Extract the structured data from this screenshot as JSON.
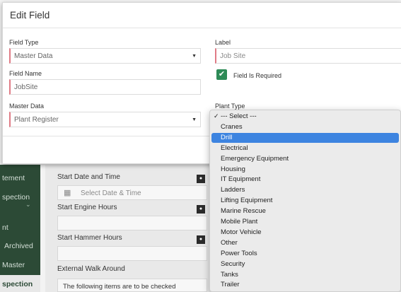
{
  "modal": {
    "title": "Edit Field",
    "field_type": {
      "label": "Field Type",
      "value": "Master Data"
    },
    "field_label": {
      "label": "Label",
      "placeholder": "Job Site"
    },
    "field_name": {
      "label": "Field Name",
      "value": "JobSite"
    },
    "required": {
      "label": "Field Is Required",
      "checked": true
    },
    "master_data": {
      "label": "Master Data",
      "value": "Plant Register"
    },
    "plant_type": {
      "label": "Plant Type"
    }
  },
  "dropdown": {
    "options": [
      {
        "label": "--- Select ---",
        "checked": true
      },
      {
        "label": "Cranes"
      },
      {
        "label": "Drill",
        "highlighted": true
      },
      {
        "label": "Electrical"
      },
      {
        "label": "Emergency Equipment"
      },
      {
        "label": "Housing"
      },
      {
        "label": "IT Equipment"
      },
      {
        "label": "Ladders"
      },
      {
        "label": "Lifting Equipment"
      },
      {
        "label": "Marine Rescue"
      },
      {
        "label": "Mobile Plant"
      },
      {
        "label": "Motor Vehicle"
      },
      {
        "label": "Other"
      },
      {
        "label": "Power Tools"
      },
      {
        "label": "Security"
      },
      {
        "label": "Tanks"
      },
      {
        "label": "Trailer"
      }
    ]
  },
  "background": {
    "sidebar": [
      "tement",
      "spection",
      "nt",
      "Archived",
      "Master",
      "spection"
    ],
    "form": {
      "start_date_label": "Start Date and Time",
      "start_date_placeholder": "Select Date & Time",
      "start_engine_label": "Start Engine Hours",
      "start_hammer_label": "Start Hammer Hours",
      "walk_around_label": "External Walk Around",
      "walk_around_note": "The following items are to be checked"
    }
  },
  "colors": {
    "accent_check": "#2e8b57",
    "selection": "#3d84e0",
    "sidebar": "#2c4a36",
    "required_border": "#e07b86"
  },
  "icons": [
    "chevron-down-icon",
    "calendar-icon",
    "checkmark-icon"
  ]
}
